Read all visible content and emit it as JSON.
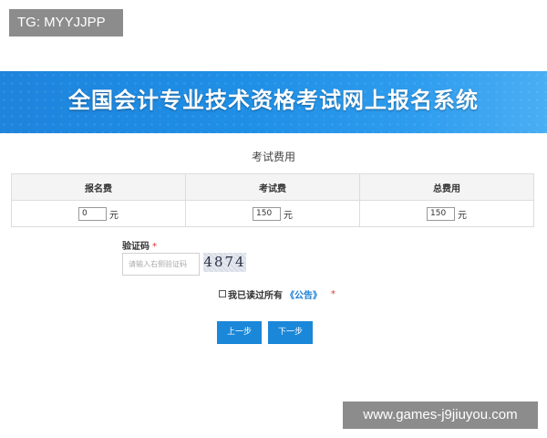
{
  "watermarks": {
    "top": "TG: MYYJJPP",
    "bottom": "www.games-j9jiuyou.com"
  },
  "banner": {
    "title": "全国会计专业技术资格考试网上报名系统"
  },
  "fees": {
    "section_title": "考试费用",
    "columns": [
      {
        "header": "报名费",
        "value": "0",
        "unit": "元"
      },
      {
        "header": "考试费",
        "value": "150",
        "unit": "元"
      },
      {
        "header": "总费用",
        "value": "150",
        "unit": "元"
      }
    ]
  },
  "captcha": {
    "label": "验证码",
    "required_mark": "*",
    "placeholder": "请输入右侧验证码",
    "code": "4874"
  },
  "agreement": {
    "text": "我已读过所有",
    "link": "《公告》",
    "required_mark": "*",
    "checked": false
  },
  "buttons": {
    "prev": "上一步",
    "next": "下一步"
  },
  "colors": {
    "banner": "#1e84dc",
    "button": "#1b87d8",
    "link": "#1a7fd4",
    "required": "#e03030"
  }
}
